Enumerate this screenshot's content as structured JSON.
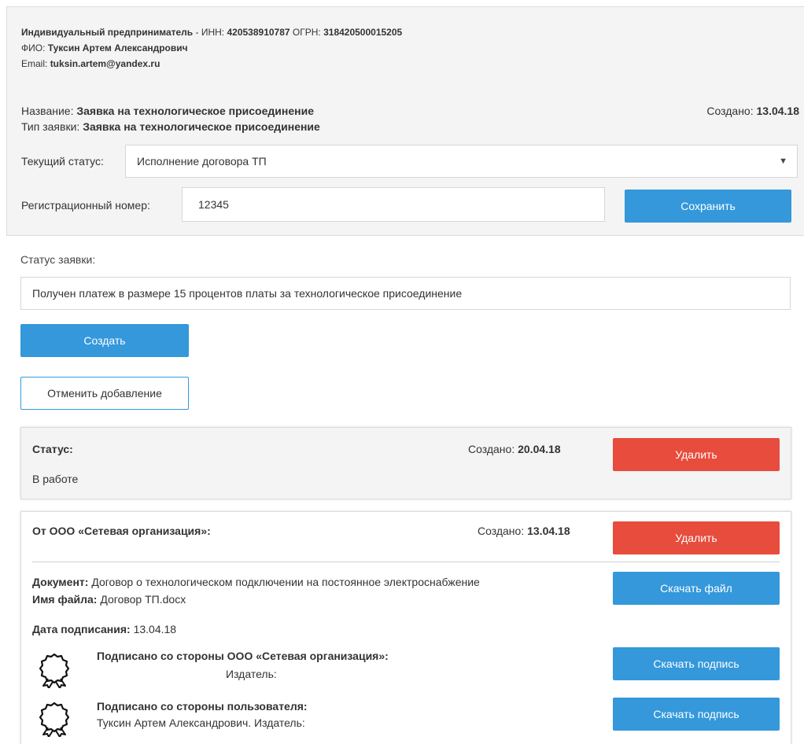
{
  "entrepreneur": {
    "type_label": "Индивидуальный предприниматель",
    "inn_label": " - ИНН: ",
    "inn": "420538910787",
    "ogrn_label": " ОГРН: ",
    "ogrn": "318420500015205",
    "fio_label": "ФИО: ",
    "fio": "Туксин Артем Александрович",
    "email_label": "Email: ",
    "email": "tuksin.artem@yandex.ru"
  },
  "request": {
    "name_label": "Название: ",
    "name": "Заявка на технологическое присоединение",
    "type_label": "Тип заявки: ",
    "type": "Заявка на технологическое присоединение",
    "created_label": "Создано: ",
    "created": "13.04.18",
    "status_label": "Текущий статус:",
    "status_value": "Исполнение договора ТП",
    "reg_label": "Регистрационный номер:",
    "reg_value": "12345",
    "save_label": "Сохранить"
  },
  "new_status": {
    "label": "Статус заявки:",
    "value": "Получен платеж в размере 15 процентов платы за технологическое присоединение",
    "create_label": "Создать",
    "cancel_label": "Отменить добавление"
  },
  "status_card": {
    "title": "Статус:",
    "created_label": "Создано: ",
    "created": "20.04.18",
    "text": "В работе",
    "delete_label": "Удалить"
  },
  "doc_card": {
    "title": "От ООО «Сетевая организация»:",
    "created_label": "Создано: ",
    "created": "13.04.18",
    "delete_label": "Удалить",
    "document_label": "Документ: ",
    "document": "Договор о технологическом подключении на постоянное электроснабжение",
    "filename_label": "Имя файла: ",
    "filename": "Договор ТП.docx",
    "download_file_label": "Скачать файл",
    "sign_date_label": "Дата подписания: ",
    "sign_date": "13.04.18",
    "signer1_title": "Подписано со стороны ООО «Сетевая организация»:",
    "signer1_sub": "Издатель:",
    "signer2_title": "Подписано со стороны пользователя:",
    "signer2_sub": "Туксин Артем Александрович. Издатель:",
    "download_sig_label": "Скачать подпись",
    "seal_icon": "certificate-seal-icon"
  }
}
